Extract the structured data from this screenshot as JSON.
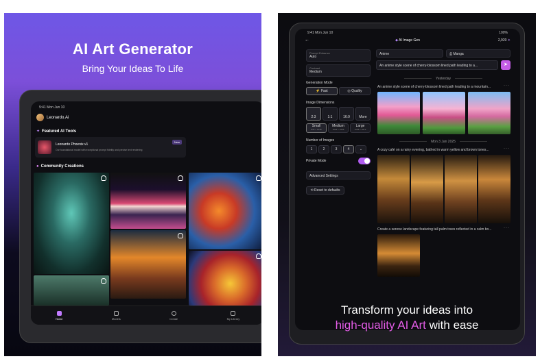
{
  "left": {
    "headline": "AI Art Generator",
    "subheadline": "Bring Your Ideas To Life",
    "status_time": "9:41  Mon Jun 10",
    "brand": "Leonardo.Ai",
    "featured_title": "Featured AI Tools",
    "featured_card": {
      "title": "Leonardo Phoenix v1",
      "desc": "Our foundational model with exceptional prompt fidelity and precise text rendering",
      "badge": "New"
    },
    "community_title": "Community Creations",
    "nav": [
      "Home",
      "Models",
      "Create",
      "My Library"
    ]
  },
  "right": {
    "status_time": "9:41  Mon Jun 10",
    "status_battery": "100%",
    "header_title": "AI Image Gen",
    "credits": "2,920",
    "prompt_enhance_label": "Prompt Enhance",
    "prompt_enhance_value": "Auto",
    "contrast_label": "Contrast",
    "contrast_value": "Medium",
    "generation_mode_label": "Generation Mode",
    "mode_fast": "Fast",
    "mode_quality": "Quality",
    "image_dimensions_label": "Image Dimensions",
    "ratios": [
      "2:3",
      "1:1",
      "16:9",
      "More"
    ],
    "sizes": [
      {
        "label": "Small",
        "sub": "832 × 1248"
      },
      {
        "label": "Medium",
        "sub": "1024 × 1536"
      },
      {
        "label": "Large",
        "sub": "1248 × 1872"
      }
    ],
    "number_of_images_label": "Number of Images",
    "counts": [
      "1",
      "2",
      "3",
      "4"
    ],
    "private_mode_label": "Private Mode",
    "advanced_settings": "Advanced Settings",
    "reset": "Reset to defaults",
    "style_1": "Anime",
    "style_2": "Manga",
    "prompt_text": "An anime style scene of cherry-blossom lined path leading to a...",
    "sep_1": "Yesterday",
    "caption_1": "An anime style scene of cherry-blossom lined path leading to a mountain...",
    "sep_2": "Mon 3 Jan 2025",
    "caption_2": "A cozy café on a rainy evening, bathed in warm yellow and brown tones...",
    "caption_3": "Create a serene landscape featuring tall palm trees reflected in a calm bo...",
    "tagline_line1": "Transform your ideas into",
    "tagline_highlight": "high-quality AI Art",
    "tagline_end": "with ease",
    "accent_pink": "#e25ce6",
    "accent_purple": "#a56bff"
  }
}
